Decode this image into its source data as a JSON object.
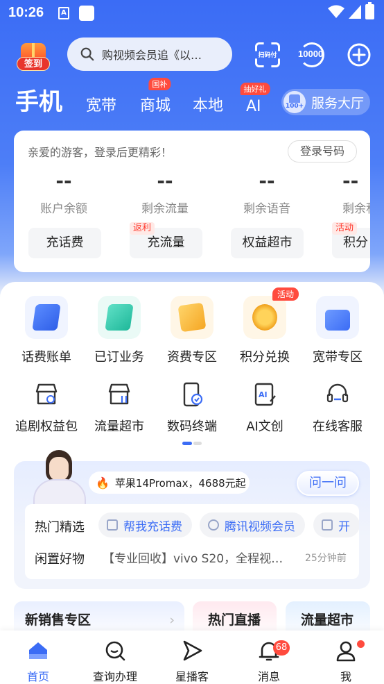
{
  "status_bar": {
    "time": "10:26",
    "app_icon_letter": "A"
  },
  "header": {
    "sign_in_label": "签到",
    "search_placeholder": "购视频会员追《以…",
    "scan_label": "扫码付",
    "num_label": "10000"
  },
  "tabs": [
    {
      "label": "手机",
      "badge": ""
    },
    {
      "label": "宽带",
      "badge": ""
    },
    {
      "label": "商城",
      "badge": "国补"
    },
    {
      "label": "本地",
      "badge": ""
    },
    {
      "label": "AI",
      "badge": "抽好礼"
    }
  ],
  "service_hall": {
    "label": "服务大厅",
    "icon_text": "100+"
  },
  "account": {
    "greeting": "亲爱的游客，登录后更精彩！",
    "login_label": "登录号码",
    "metrics": [
      {
        "value": "--",
        "label": "账户余额"
      },
      {
        "value": "--",
        "label": "剩余流量"
      },
      {
        "value": "--",
        "label": "剩余语音"
      },
      {
        "value": "--",
        "label": "剩余积"
      }
    ],
    "actions": [
      {
        "label": "充话费",
        "badge": ""
      },
      {
        "label": "充流量",
        "badge": "返利"
      },
      {
        "label": "权益超市",
        "badge": ""
      },
      {
        "label": "积分",
        "badge": "活动"
      }
    ]
  },
  "grid_row1": [
    {
      "label": "话费账单",
      "badge": ""
    },
    {
      "label": "已订业务",
      "badge": ""
    },
    {
      "label": "资费专区",
      "badge": ""
    },
    {
      "label": "积分兑换",
      "badge": "活动"
    },
    {
      "label": "宽带专区",
      "badge": ""
    }
  ],
  "grid_row2": [
    {
      "label": "追剧权益包"
    },
    {
      "label": "流量超市"
    },
    {
      "label": "数码终端"
    },
    {
      "label": "AI文创"
    },
    {
      "label": "在线客服"
    }
  ],
  "ai_card": {
    "promo": "苹果14Promax，4688元起",
    "ask_label": "问一问",
    "hot_title": "热门精选",
    "chips": [
      "帮我充话费",
      "腾讯视频会员",
      "开"
    ],
    "idle_title": "闲置好物",
    "idle_text": "【专业回收】vivo S20，全程视…",
    "idle_time": "25分钟前"
  },
  "zones": [
    "新销售专区",
    "热门直播",
    "流量超市"
  ],
  "bottom_nav": [
    {
      "label": "首页"
    },
    {
      "label": "查询办理"
    },
    {
      "label": "星播客"
    },
    {
      "label": "消息",
      "badge": "68"
    },
    {
      "label": "我"
    }
  ],
  "colors": {
    "brand_blue": "#3b6cf5",
    "badge_red": "#ff4b3e"
  }
}
